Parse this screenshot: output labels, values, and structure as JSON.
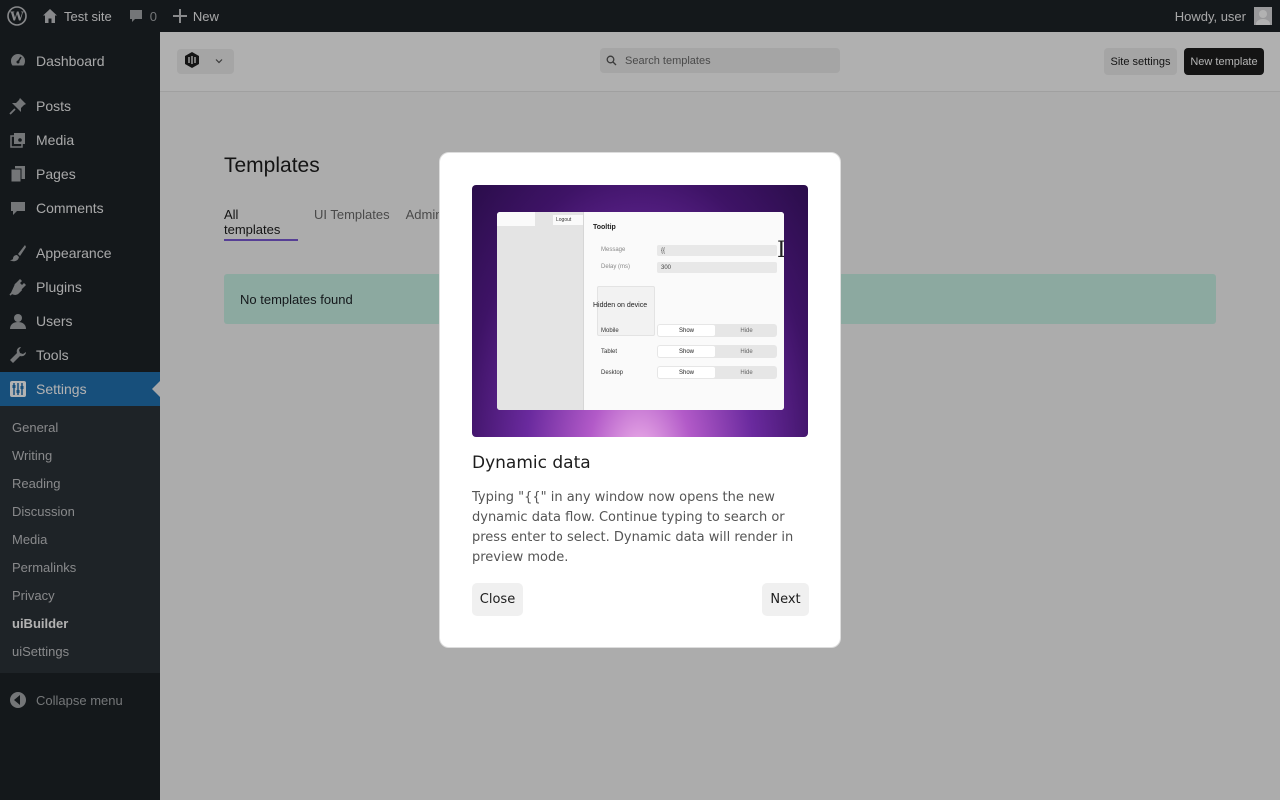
{
  "adminbar": {
    "site_name": "Test site",
    "comments_count": "0",
    "new_label": "New",
    "greeting": "Howdy, user"
  },
  "menu": {
    "items": [
      {
        "label": "Dashboard",
        "icon": "dashboard-icon"
      },
      {
        "label": "Posts",
        "icon": "pin-icon"
      },
      {
        "label": "Media",
        "icon": "media-icon"
      },
      {
        "label": "Pages",
        "icon": "pages-icon"
      },
      {
        "label": "Comments",
        "icon": "comments-icon"
      },
      {
        "label": "Appearance",
        "icon": "brush-icon"
      },
      {
        "label": "Plugins",
        "icon": "plug-icon"
      },
      {
        "label": "Users",
        "icon": "user-icon"
      },
      {
        "label": "Tools",
        "icon": "wrench-icon"
      },
      {
        "label": "Settings",
        "icon": "sliders-icon"
      }
    ],
    "submenu": [
      "General",
      "Writing",
      "Reading",
      "Discussion",
      "Media",
      "Permalinks",
      "Privacy",
      "uiBuilder",
      "uiSettings"
    ],
    "collapse_label": "Collapse menu"
  },
  "topbar": {
    "search_placeholder": "Search templates",
    "site_settings": "Site settings",
    "new_template": "New template"
  },
  "page": {
    "title": "Templates",
    "tabs": [
      "All templates",
      "UI Templates",
      "Admin"
    ],
    "notice": "No templates found"
  },
  "modal": {
    "title": "Dynamic data",
    "description": "Typing \"{{\" in any window now opens the new dynamic data flow. Continue typing to search or press enter to select. Dynamic data will render in preview mode.",
    "close_label": "Close",
    "next_label": "Next",
    "preview": {
      "logout": "Logout",
      "panel_title": "Tooltip",
      "message_label": "Message",
      "message_value": "{{",
      "delay_label": "Delay (ms)",
      "delay_value": "300",
      "section_heading": "Hidden on device",
      "devices": [
        "Mobile",
        "Tablet",
        "Desktop"
      ],
      "show_label": "Show",
      "hide_label": "Hide"
    }
  },
  "colors": {
    "admin_bg": "#1d2327",
    "accent": "#2271b1",
    "notice_bg": "#c9f2e5",
    "tab_underline": "#7b5bd6"
  }
}
